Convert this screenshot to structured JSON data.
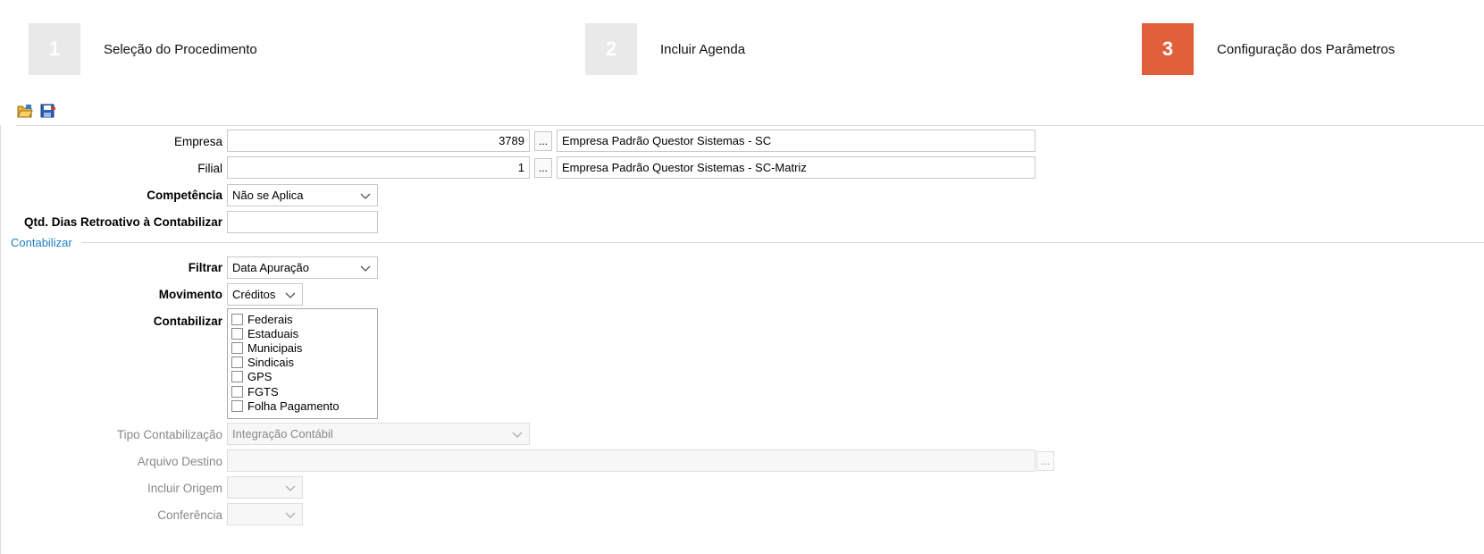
{
  "wizard": {
    "steps": [
      {
        "number": "1",
        "label": "Seleção do Procedimento",
        "active": false
      },
      {
        "number": "2",
        "label": "Incluir Agenda",
        "active": false
      },
      {
        "number": "3",
        "label": "Configuração dos Parâmetros",
        "active": true
      }
    ]
  },
  "toolbar": {
    "buttons": [
      {
        "icon": "open-folder-icon"
      },
      {
        "icon": "save-icon"
      }
    ]
  },
  "form": {
    "empresa": {
      "label": "Empresa",
      "code": "3789",
      "name": "Empresa Padrão Questor Sistemas - SC"
    },
    "filial": {
      "label": "Filial",
      "code": "1",
      "name": "Empresa Padrão Questor Sistemas - SC-Matriz"
    },
    "competencia": {
      "label": "Competência",
      "value": "Não se Aplica"
    },
    "qtd_dias": {
      "label": "Qtd. Dias Retroativo à Contabilizar",
      "value": ""
    },
    "section_title": "Contabilizar",
    "filtrar": {
      "label": "Filtrar",
      "value": "Data Apuração"
    },
    "movimento": {
      "label": "Movimento",
      "value": "Créditos"
    },
    "contabilizar": {
      "label": "Contabilizar",
      "options": [
        "Federais",
        "Estaduais",
        "Municipais",
        "Sindicais",
        "GPS",
        "FGTS",
        "Folha Pagamento"
      ]
    },
    "tipo_contabilizacao": {
      "label": "Tipo Contabilização",
      "value": "Integração Contábil"
    },
    "arquivo_destino": {
      "label": "Arquivo Destino",
      "value": ""
    },
    "incluir_origem": {
      "label": "Incluir Origem",
      "value": ""
    },
    "conferencia": {
      "label": "Conferência",
      "value": ""
    },
    "ellipsis": "..."
  },
  "colors": {
    "accent": "#e0603a",
    "section": "#1e7fc1",
    "step_inactive": "#e9e9e9"
  }
}
